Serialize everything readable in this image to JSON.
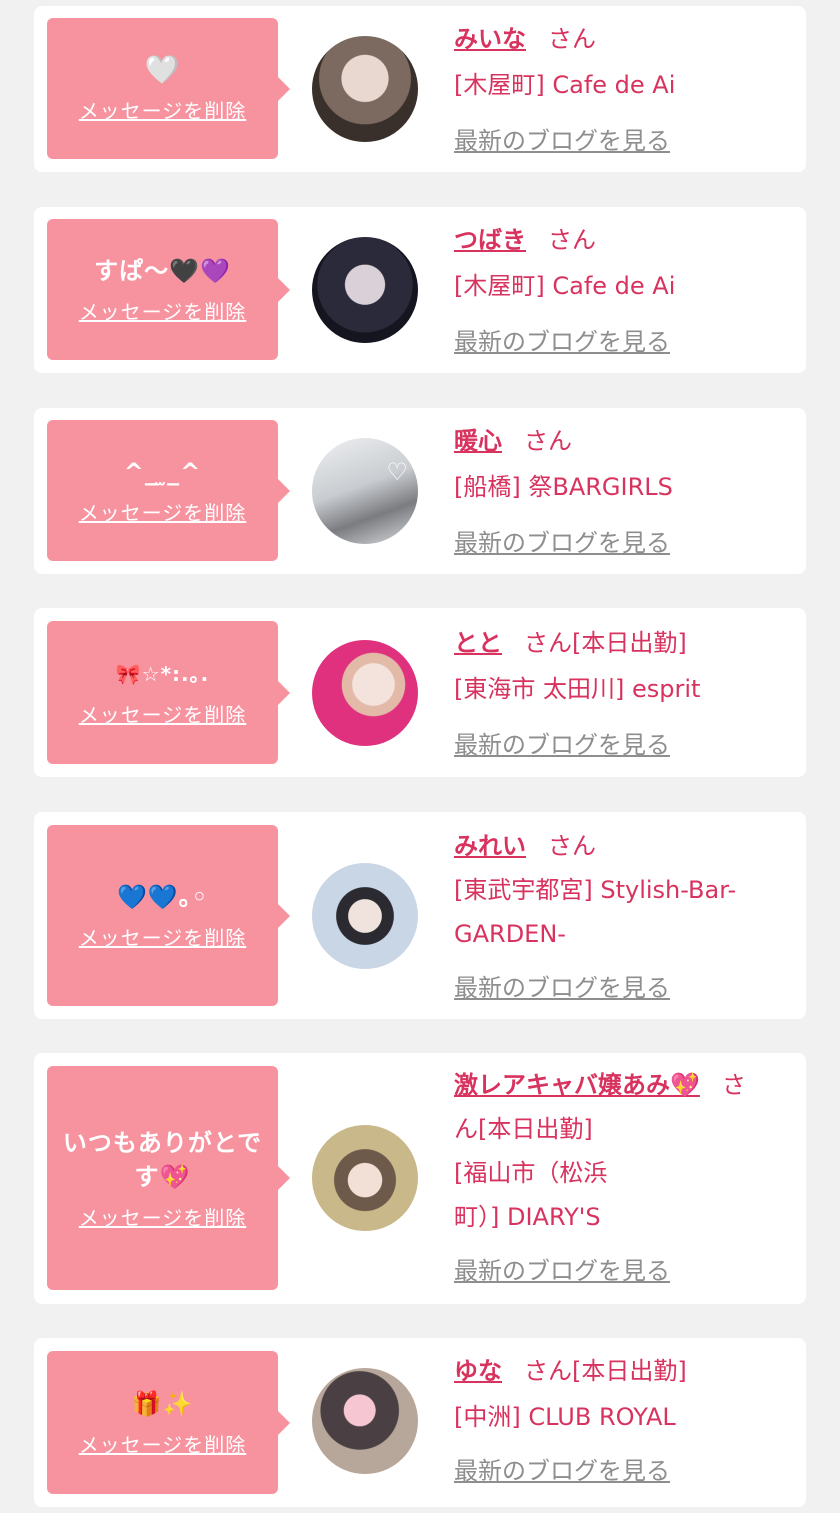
{
  "delete_label": "メッセージを削除",
  "blog_label": "最新のブログを見る",
  "san_label": "さん",
  "items": [
    {
      "message": "🤍",
      "name": "みいな",
      "after_san": "",
      "shop": "[木屋町] Cafe de Ai",
      "avatar_icon": "avatar-photo"
    },
    {
      "message": "すぱ〜🖤💜",
      "name": "つばき",
      "after_san": "",
      "shop": "[木屋町] Cafe de Ai",
      "avatar_icon": "avatar-photo"
    },
    {
      "message": "^_ ̫_^",
      "name": "暖心",
      "after_san": "",
      "shop": "[船橋] 祭BARGIRLS",
      "avatar_icon": "avatar-photo"
    },
    {
      "message": "🎀☆*:.｡.",
      "name": "とと",
      "after_san": "[本日出勤]",
      "shop": "[東海市 太田川] esprit",
      "avatar_icon": "avatar-photo"
    },
    {
      "message": "💙💙｡◦",
      "name": "みれい",
      "after_san": "",
      "shop_line1": "[東武宇都宮] Stylish-Bar-",
      "shop_line2": "GARDEN-",
      "avatar_icon": "avatar-photo"
    },
    {
      "message_line1": "いつもありがとで",
      "message_line2": "す💖",
      "name": "激レアキャバ嬢あみ💖",
      "san_part1": "さ",
      "san_part2": "ん[本日出勤]",
      "shop_line1": "[福山市（松浜",
      "shop_line2": "町）] DIARY'S",
      "avatar_icon": "avatar-photo"
    },
    {
      "message": "🎁✨",
      "name": "ゆな",
      "after_san": "[本日出勤]",
      "shop": "[中洲] CLUB ROYAL",
      "avatar_icon": "avatar-photo"
    }
  ]
}
